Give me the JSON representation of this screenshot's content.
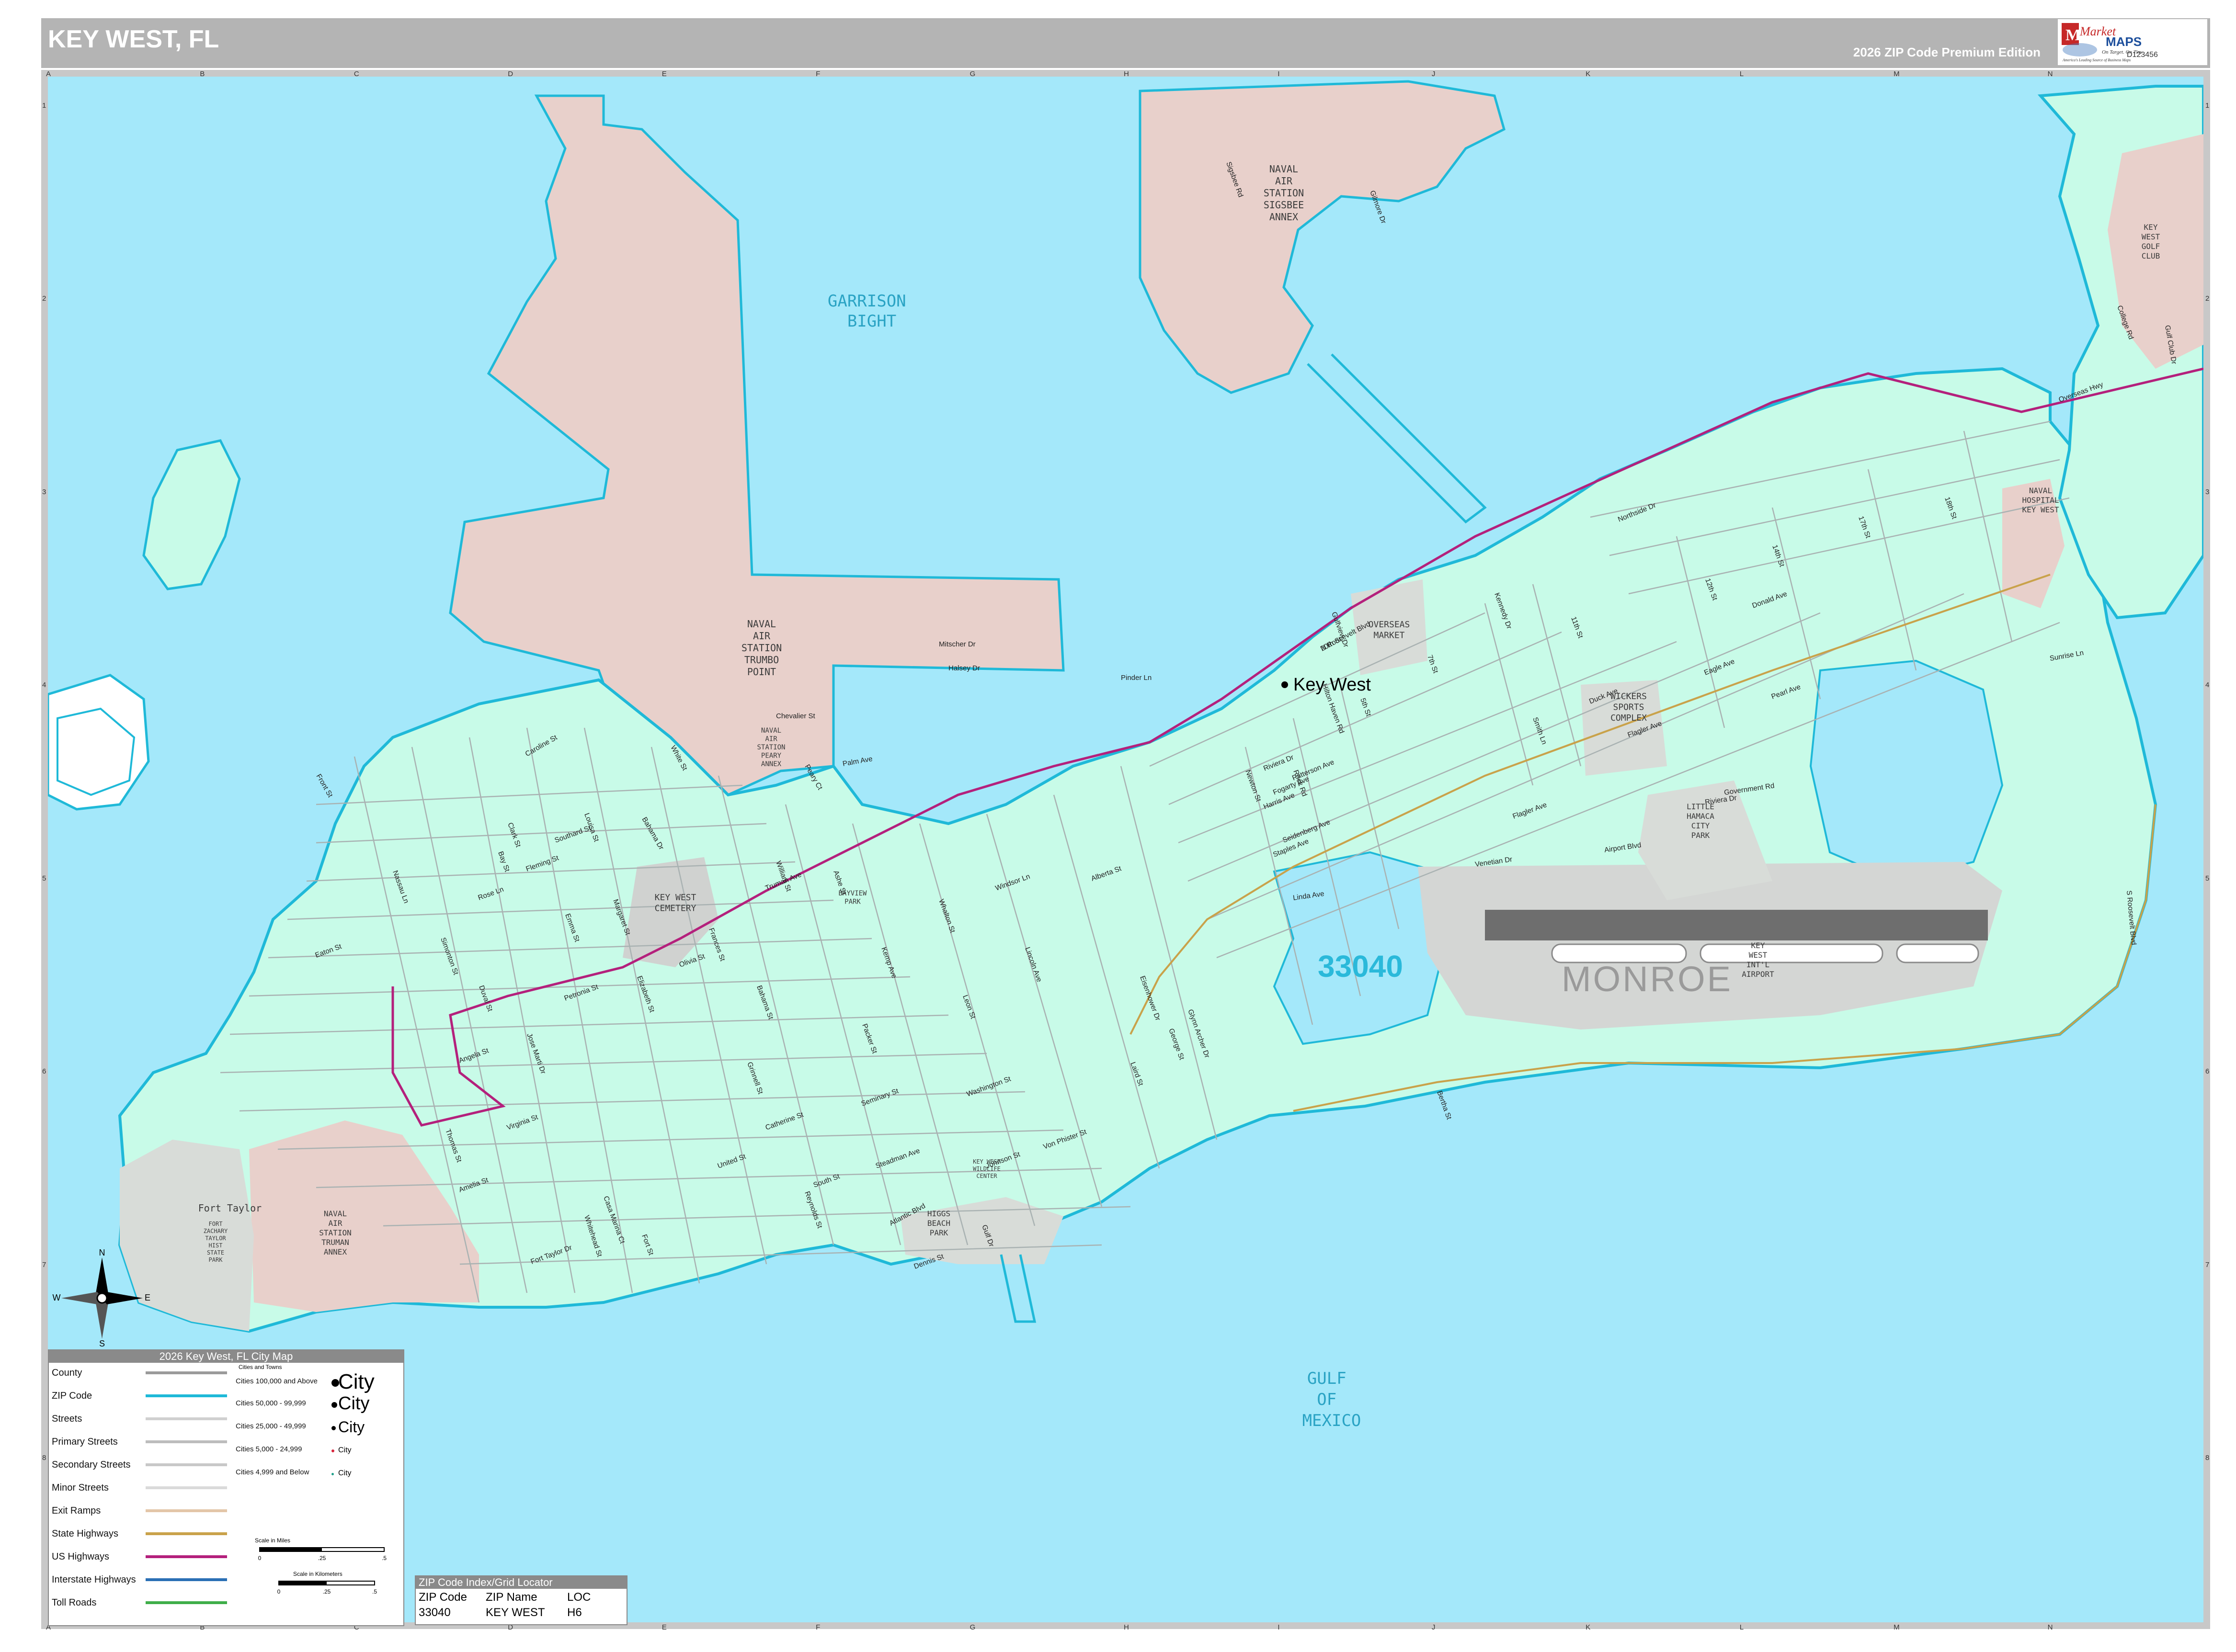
{
  "map": {
    "title": "KEY WEST, FL",
    "edition": "2026 ZIP Code Premium Edition",
    "brand": {
      "name_line1": "Market",
      "name_line2": "MAPS",
      "tagline": "On Target. On Time.",
      "subline": "America's Leading Source of Business Maps",
      "id": "D123456"
    },
    "colors": {
      "water": "#a4e8fa",
      "land_zip": "#c8fbe8",
      "military": "#e8d0cb",
      "parks": "#d8dcd8",
      "airport": "#d4d6d4",
      "zip_boundary": "#1fb9d8",
      "us_highway": "#b4207c",
      "state_highway": "#c9a24a",
      "street": "#9aa3a3"
    },
    "grid": {
      "columns": [
        "A",
        "B",
        "C",
        "D",
        "E",
        "F",
        "G",
        "H",
        "I",
        "J",
        "K",
        "L",
        "M",
        "N"
      ],
      "rows": [
        "1",
        "2",
        "3",
        "4",
        "5",
        "6",
        "7",
        "8"
      ]
    },
    "zip_label": "33040",
    "county_label": "MONROE",
    "city_label": "Key West",
    "water_labels": [
      {
        "text": [
          "GARRISON",
          "BIGHT"
        ]
      },
      {
        "text": [
          "GULF",
          "OF",
          "MEXICO"
        ]
      }
    ],
    "place_labels": [
      {
        "text": [
          "NAVAL",
          "AIR",
          "STATION",
          "SIGSBEE",
          "ANNEX"
        ]
      },
      {
        "text": [
          "NAVAL",
          "AIR",
          "STATION",
          "TRUMBO",
          "POINT"
        ]
      },
      {
        "text": [
          "NAVAL",
          "AIR",
          "STATION",
          "PEARY",
          "ANNEX"
        ]
      },
      {
        "text": [
          "KEY WEST",
          "CEMETERY"
        ]
      },
      {
        "text": [
          "BAYVIEW",
          "PARK"
        ]
      },
      {
        "text": [
          "OVERSEAS",
          "MARKET"
        ]
      },
      {
        "text": [
          "WICKERS",
          "SPORTS",
          "COMPLEX"
        ]
      },
      {
        "text": [
          "LITTLE",
          "HAMACA",
          "CITY",
          "PARK"
        ]
      },
      {
        "text": [
          "KEY",
          "WEST",
          "INT'L",
          "AIRPORT"
        ]
      },
      {
        "text": [
          "NAVAL",
          "HOSPITAL",
          "KEY WEST"
        ]
      },
      {
        "text": [
          "KEY",
          "WEST",
          "GOLF",
          "CLUB"
        ]
      },
      {
        "text": [
          "HIGGS",
          "BEACH",
          "PARK"
        ]
      },
      {
        "text": [
          "NAVAL",
          "AIR",
          "STATION",
          "TRUMAN",
          "ANNEX"
        ]
      },
      {
        "text": [
          "FORT",
          "ZACHARY",
          "TAYLOR",
          "HIST",
          "STATE",
          "PARK"
        ]
      },
      {
        "text": [
          "Fort Taylor"
        ]
      },
      {
        "text": [
          "KEY WEST",
          "WILDLIFE",
          "CENTER"
        ]
      }
    ],
    "street_labels": [
      "N Roosevelt Blvd",
      "S Roosevelt Blvd",
      "Flagler Ave",
      "Atlantic Blvd",
      "Truman Ave",
      "Duval St",
      "Whitehead St",
      "Simonton St",
      "White St",
      "Eaton St",
      "Fleming St",
      "Southard St",
      "Angela St",
      "Petronia St",
      "Olivia St",
      "United St",
      "South St",
      "Catherine St",
      "Amelia St",
      "Virginia St",
      "Seminary St",
      "Bertha St",
      "George St",
      "Kennedy Dr",
      "Duck Ave",
      "Eagle Ave",
      "Staples Ave",
      "Patterson Ave",
      "Harris Ave",
      "Northside Dr",
      "Overseas Hwy",
      "Palm Ave",
      "Caroline St",
      "Front St",
      "Reynolds St",
      "Bahama Dr",
      "Riviera Dr",
      "Government Rd",
      "Airport Blvd",
      "Linda Ave",
      "Venetian Dr",
      "Seidenberg Ave",
      "Fogarty Ave",
      "Laird St",
      "Leon St",
      "Flagler Ave",
      "Donald Ave",
      "Pearl Ave",
      "Sunrise Ln",
      "Mitscher Dr",
      "Halsey Dr",
      "Chevalier St",
      "Fort Taylor Dr",
      "Emma St",
      "Thomas St",
      "Grinnell St",
      "Elizabeth St",
      "Frances St",
      "Margaret St",
      "William St",
      "Ashe St",
      "Bahama St",
      "Packer St",
      "Johnson St",
      "Von Phister St",
      "Washington St",
      "Alberta St",
      "Rose Ln",
      "Gulfview Dr",
      "Lincoln Ave",
      "College Rd",
      "Gulf Club Dr",
      "Sigsbee Rd",
      "Gilmore Dr",
      "Peary Ct",
      "Whalton St",
      "Eisenhower Dr",
      "Kemp Ave",
      "Bay St",
      "Nassau Ln",
      "Pinder Ln",
      "Hilton Haven Rd",
      "Riviera Dr",
      "Dennis St",
      "Jose Marti Dr",
      "Gulf Dr",
      "Smith Ln",
      "Glynn Archer Dr",
      "Steadman Ave",
      "Casa Marina Ct",
      "Fort St",
      "Clark St",
      "Louisa St",
      "Windsor Ln",
      "Newton St",
      "Rock Rd",
      "5th St",
      "7th St",
      "11th St",
      "12th St",
      "14th St",
      "17th St",
      "18th St",
      "20th St"
    ],
    "legend": {
      "title": "2026 Key West, FL City Map",
      "items": [
        {
          "label": "County",
          "color": "#9a9a9a"
        },
        {
          "label": "ZIP Code",
          "color": "#1fb9d8"
        },
        {
          "label": "Streets",
          "color": "#d0d0d0"
        },
        {
          "label": "Primary Streets",
          "color": "#bdbdbd"
        },
        {
          "label": "Secondary Streets",
          "color": "#c8c8c8"
        },
        {
          "label": "Minor Streets",
          "color": "#dadada"
        },
        {
          "label": "Exit Ramps",
          "color": "#e3c6a8"
        },
        {
          "label": "State Highways",
          "color": "#c9a24a"
        },
        {
          "label": "US Highways",
          "color": "#b4207c"
        },
        {
          "label": "Interstate Highways",
          "color": "#2a6fb5"
        },
        {
          "label": "Toll Roads",
          "color": "#3fae49"
        }
      ],
      "cities_heading": "Cities and Towns",
      "cities": [
        {
          "label": "Cities 100,000 and Above",
          "name": "City"
        },
        {
          "label": "Cities 50,000 - 99,999",
          "name": "City"
        },
        {
          "label": "Cities 25,000 - 49,999",
          "name": "City"
        },
        {
          "label": "Cities 5,000 - 24,999",
          "name": "City"
        },
        {
          "label": "Cities 4,999 and Below",
          "name": "City"
        }
      ],
      "scale_miles_label": "Scale in Miles",
      "scale_km_label": "Scale in Kilometers",
      "scale_miles_ticks": [
        "0",
        ".25",
        ".5"
      ],
      "scale_km_ticks": [
        "0",
        ".25",
        ".5"
      ]
    },
    "zip_index": {
      "title": "ZIP Code Index/Grid Locator",
      "headers": [
        "ZIP Code",
        "ZIP Name",
        "LOC"
      ],
      "rows": [
        [
          "33040",
          "KEY WEST",
          "H6"
        ]
      ]
    },
    "compass": {
      "n": "N",
      "s": "S",
      "e": "E",
      "w": "W"
    }
  }
}
